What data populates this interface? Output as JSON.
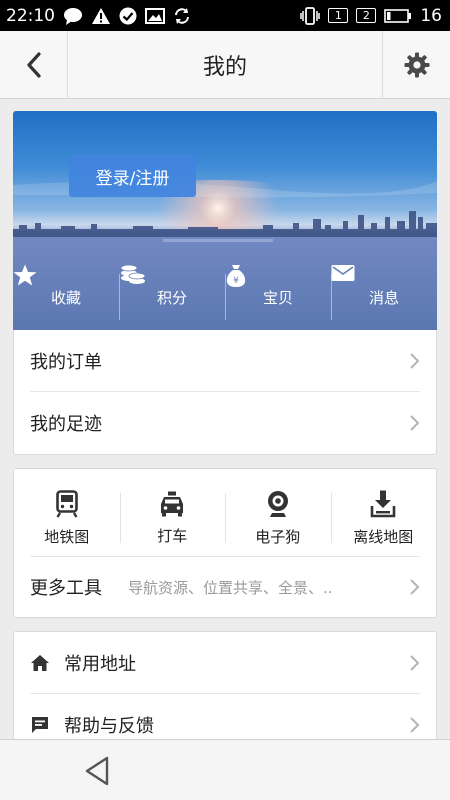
{
  "status_bar": {
    "time": "22:10",
    "left_icons": [
      "chat-icon",
      "warning-icon",
      "check-circle-icon",
      "image-icon",
      "sync-icon"
    ],
    "right_icons": [
      "vibrate-icon",
      "sim-1-icon",
      "sim-2-icon",
      "battery-icon"
    ],
    "sim1": "1",
    "sim2": "2",
    "battery": "16"
  },
  "header": {
    "title": "我的",
    "back_icon": "chevron-left-icon",
    "settings_icon": "gear-icon"
  },
  "banner": {
    "login_label": "登录/注册",
    "items": [
      {
        "label": "收藏",
        "icon": "star-icon"
      },
      {
        "label": "积分",
        "icon": "coins-icon"
      },
      {
        "label": "宝贝",
        "icon": "money-bag-icon"
      },
      {
        "label": "消息",
        "icon": "envelope-icon"
      }
    ]
  },
  "account_list": [
    {
      "label": "我的订单"
    },
    {
      "label": "我的足迹"
    }
  ],
  "tools": {
    "items": [
      {
        "label": "地铁图",
        "icon": "subway-icon"
      },
      {
        "label": "打车",
        "icon": "taxi-icon"
      },
      {
        "label": "电子狗",
        "icon": "webcam-icon"
      },
      {
        "label": "离线地图",
        "icon": "download-icon"
      }
    ],
    "more_label": "更多工具",
    "more_desc": "导航资源、位置共享、全景、.."
  },
  "misc_list": [
    {
      "label": "常用地址",
      "icon": "home-icon"
    },
    {
      "label": "帮助与反馈",
      "icon": "feedback-icon"
    }
  ],
  "nav_bar": {
    "back_icon": "triangle-back-icon"
  },
  "colors": {
    "status_bar": "#000000",
    "header_bg": "#f7f7f7",
    "page_bg": "#ececec",
    "login_button": "#4285de",
    "secondary_text": "#9a9a9a"
  }
}
